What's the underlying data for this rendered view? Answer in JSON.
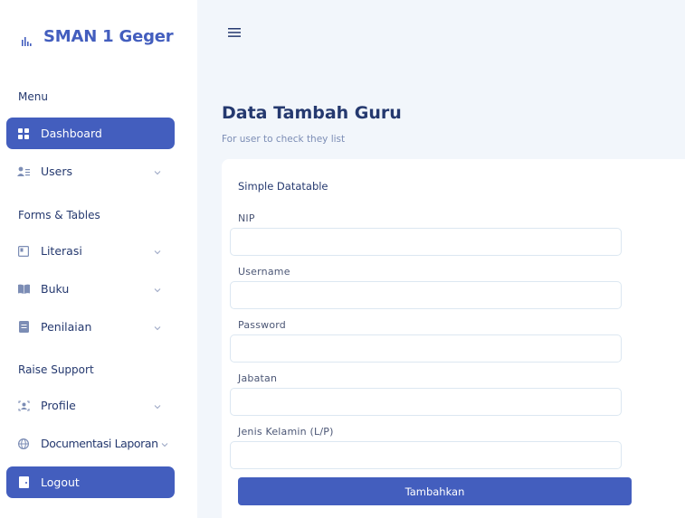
{
  "sidebar": {
    "brand": "SMAN 1 Geger",
    "sections": {
      "menu": "Menu",
      "forms": "Forms & Tables",
      "support": "Raise Support"
    },
    "items": {
      "dashboard": "Dashboard",
      "users": "Users",
      "literasi": "Literasi",
      "buku": "Buku",
      "penilaian": "Penilaian",
      "profile": "Profile",
      "documentasi": "Documentasi Laporan",
      "logout": "Logout"
    },
    "icons": {
      "brand": "bar-chart-icon",
      "dashboard": "grid-icon",
      "users": "people-icon",
      "literasi": "file-icon",
      "buku": "book-icon",
      "penilaian": "clipboard-icon",
      "profile": "person-badge-icon",
      "documentasi": "globe-icon",
      "logout": "door-icon"
    }
  },
  "header": {
    "menu_icon": "hamburger-icon"
  },
  "page": {
    "title": "Data Tambah Guru",
    "subtitle": "For user to check they list"
  },
  "card": {
    "title": "Simple Datatable",
    "fields": {
      "nip": {
        "label": "NIP",
        "value": ""
      },
      "username": {
        "label": "Username",
        "value": ""
      },
      "password": {
        "label": "Password",
        "value": ""
      },
      "jabatan": {
        "label": "Jabatan",
        "value": ""
      },
      "jenis_kelamin": {
        "label": "Jenis Kelamin (L/P)",
        "value": ""
      }
    },
    "submit_label": "Tambahkan"
  },
  "colors": {
    "primary": "#435ebe",
    "text": "#25396f",
    "muted": "#7c8db5",
    "background": "#f2f6fb",
    "border": "#dce7f1"
  }
}
